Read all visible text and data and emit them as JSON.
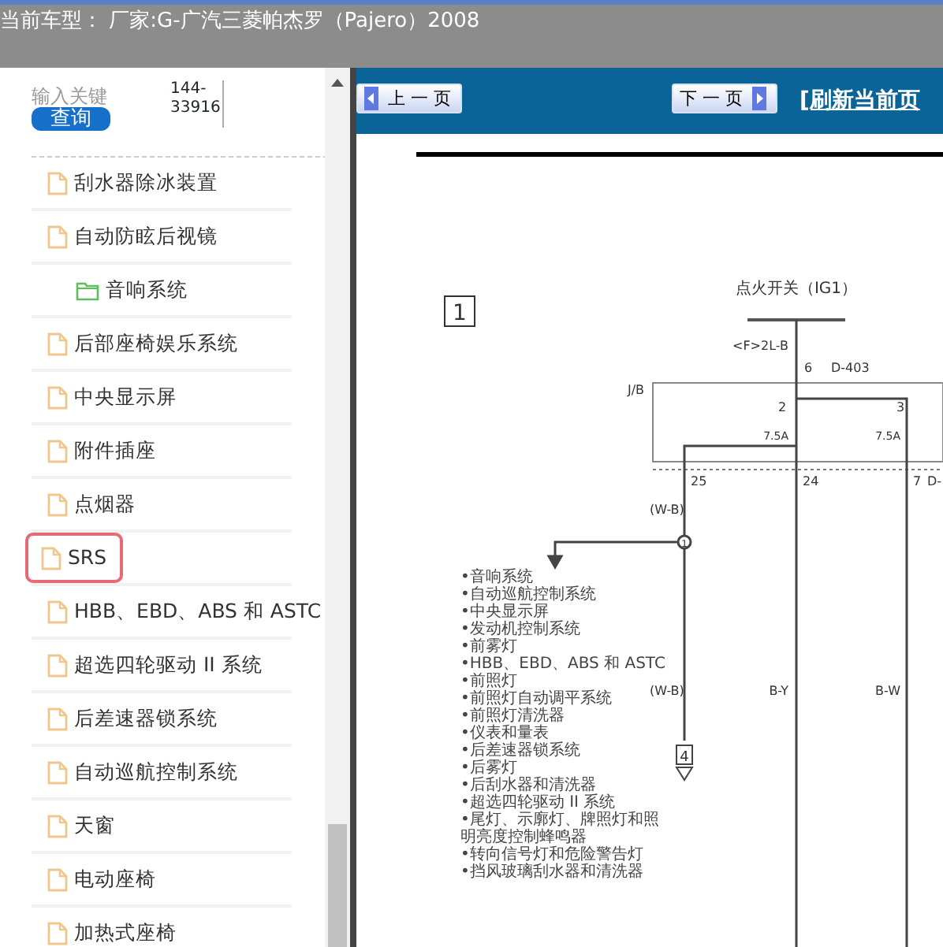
{
  "header": {
    "title": "当前车型： 厂家:G-广汽三菱帕杰罗（Pajero）2008"
  },
  "search": {
    "placeholder": "输入关键",
    "button": "查询",
    "code": "144-33916"
  },
  "sidebar": {
    "items": [
      {
        "label": "刮水器除冰装置",
        "kind": "file",
        "selected": false
      },
      {
        "label": "自动防眩后视镜",
        "kind": "file",
        "selected": false,
        "children": [
          {
            "label": "音响系统",
            "kind": "folder",
            "selected": false
          }
        ]
      },
      {
        "label": "后部座椅娱乐系统",
        "kind": "file",
        "selected": false
      },
      {
        "label": "中央显示屏",
        "kind": "file",
        "selected": false
      },
      {
        "label": "附件插座",
        "kind": "file",
        "selected": false
      },
      {
        "label": "点烟器",
        "kind": "file",
        "selected": false
      },
      {
        "label": "SRS",
        "kind": "file",
        "selected": true
      },
      {
        "label": "HBB、EBD、ABS 和 ASTC",
        "kind": "file",
        "selected": false
      },
      {
        "label": "超选四轮驱动 II 系统",
        "kind": "file",
        "selected": false
      },
      {
        "label": "后差速器锁系统",
        "kind": "file",
        "selected": false
      },
      {
        "label": "自动巡航控制系统",
        "kind": "file",
        "selected": false
      },
      {
        "label": "天窗",
        "kind": "file",
        "selected": false
      },
      {
        "label": "电动座椅",
        "kind": "file",
        "selected": false
      },
      {
        "label": "加热式座椅",
        "kind": "file",
        "selected": false
      }
    ]
  },
  "toolbar": {
    "prev": "上一页",
    "next": "下一页",
    "refresh": "[刷新当前页"
  },
  "diagram": {
    "box_label": "1",
    "ignition": "点火开关（IG1）",
    "labels": [
      "<F>2L-B",
      "6",
      "D-403",
      "J/B",
      "2",
      "7.5A",
      "3",
      "7.5A",
      "25",
      "24",
      "7",
      "D-",
      "(W-B)",
      "1",
      "(W-B)",
      "B-Y",
      "B-W",
      "4"
    ],
    "systems": [
      "•音响系统",
      "•自动巡航控制系统",
      "•中央显示屏",
      "•发动机控制系统",
      "•前雾灯",
      "•HBB、EBD、ABS 和 ASTC",
      "•前照灯",
      "•前照灯自动调平系统",
      "•前照灯清洗器",
      "•仪表和量表",
      "•后差速器锁系统",
      "•后雾灯",
      "•后刮水器和清洗器",
      "•超选四轮驱动 II 系统",
      "•尾灯、示廓灯、牌照灯和照明亮度控制蜂鸣器",
      "•转向信号灯和危险警告灯",
      "•挡风玻璃刮水器和清洗器"
    ]
  }
}
